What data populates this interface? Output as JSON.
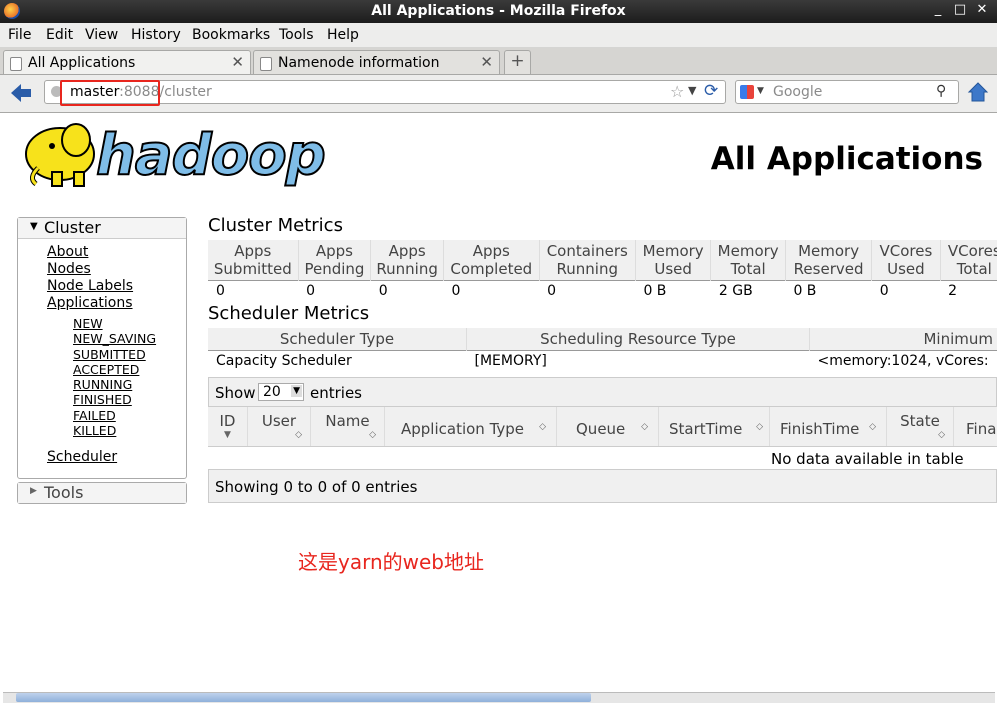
{
  "window": {
    "title": "All Applications - Mozilla Firefox"
  },
  "menu": [
    "File",
    "Edit",
    "View",
    "History",
    "Bookmarks",
    "Tools",
    "Help"
  ],
  "tabs": [
    {
      "label": "All Applications",
      "active": true
    },
    {
      "label": "Namenode information",
      "active": false
    }
  ],
  "nav": {
    "url_host": "master",
    "url_rest": ":8088/cluster",
    "search_placeholder": "Google"
  },
  "page": {
    "logo_text": "hadoop",
    "title": "All Applications"
  },
  "sidebar": {
    "cluster_title": "Cluster",
    "links": [
      "About",
      "Nodes",
      "Node Labels",
      "Applications"
    ],
    "states": [
      "NEW",
      "NEW_SAVING",
      "SUBMITTED",
      "ACCEPTED",
      "RUNNING",
      "FINISHED",
      "FAILED",
      "KILLED"
    ],
    "scheduler": "Scheduler",
    "tools_title": "Tools"
  },
  "cluster_metrics": {
    "title": "Cluster Metrics",
    "headers": [
      [
        "Apps",
        "Submitted"
      ],
      [
        "Apps",
        "Pending"
      ],
      [
        "Apps",
        "Running"
      ],
      [
        "Apps",
        "Completed"
      ],
      [
        "Containers",
        "Running"
      ],
      [
        "Memory",
        "Used"
      ],
      [
        "Memory",
        "Total"
      ],
      [
        "Memory",
        "Reserved"
      ],
      [
        "VCores",
        "Used"
      ],
      [
        "VCores",
        "Total"
      ]
    ],
    "values": [
      "0",
      "0",
      "0",
      "0",
      "0",
      "0 B",
      "2 GB",
      "0 B",
      "0",
      "2"
    ]
  },
  "scheduler_metrics": {
    "title": "Scheduler Metrics",
    "headers": [
      "Scheduler Type",
      "Scheduling Resource Type",
      "Minimum A"
    ],
    "values": [
      "Capacity Scheduler",
      "[MEMORY]",
      "<memory:1024, vCores:"
    ]
  },
  "apps_table": {
    "show_label": "Show",
    "page_size": "20",
    "entries_label": "entries",
    "headers": [
      "ID",
      "User",
      "Name",
      "Application Type",
      "Queue",
      "StartTime",
      "FinishTime",
      "State",
      "Fina"
    ],
    "empty_text": "No data available in table",
    "footer": "Showing 0 to 0 of 0 entries"
  },
  "annotation": {
    "text": "这是yarn的web地址",
    "color": "#e8261e"
  },
  "colors": {
    "highlight_box": "#e8261e",
    "logo_yellow": "#f7e21b",
    "logo_blue": "#7fbde8"
  }
}
